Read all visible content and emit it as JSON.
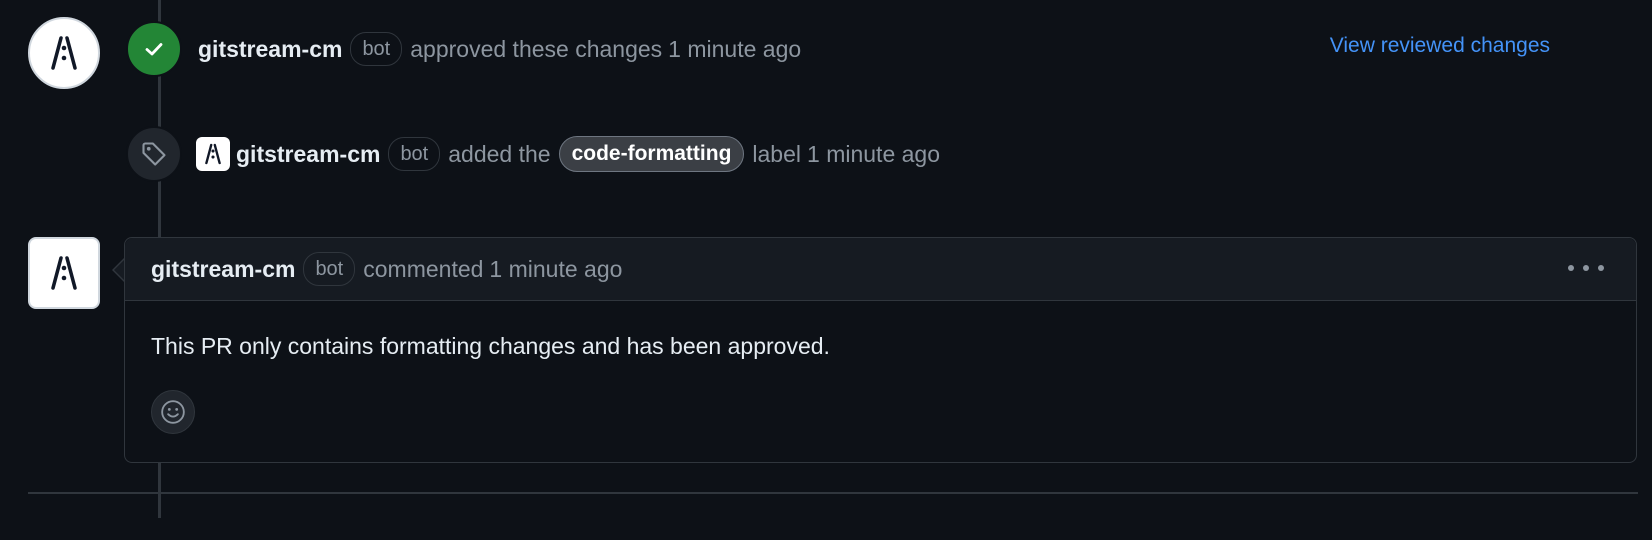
{
  "review": {
    "author": "gitstream-cm",
    "bot_tag": "bot",
    "action_text": "approved these changes",
    "time": "1 minute ago",
    "view_link": "View reviewed changes",
    "status_icon": "check-icon",
    "status_color": "#238636"
  },
  "label_event": {
    "author": "gitstream-cm",
    "bot_tag": "bot",
    "action_text": "added the",
    "label_name": "code-formatting",
    "suffix_text": "label",
    "time": "1 minute ago",
    "icon": "tag-icon"
  },
  "comment": {
    "author": "gitstream-cm",
    "bot_tag": "bot",
    "action_text": "commented",
    "time": "1 minute ago",
    "body": "This PR only contains formatting changes and has been approved.",
    "menu_icon": "kebab-horizontal-icon",
    "reaction_icon": "smiley-icon"
  },
  "colors": {
    "background": "#0d1117",
    "accent_link": "#4493f8",
    "muted_text": "#8d96a0",
    "border": "#30363d"
  }
}
